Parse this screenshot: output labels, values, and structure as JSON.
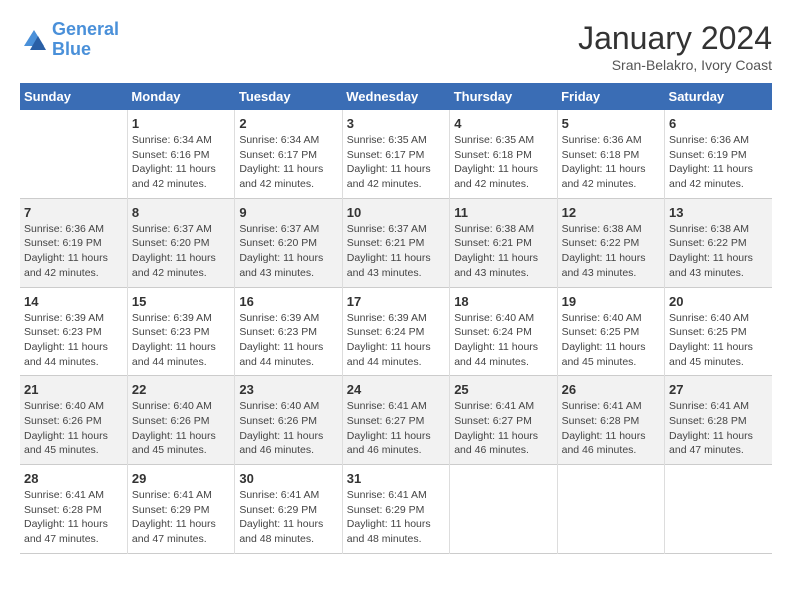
{
  "logo": {
    "text_general": "General",
    "text_blue": "Blue"
  },
  "title": "January 2024",
  "subtitle": "Sran-Belakro, Ivory Coast",
  "days_of_week": [
    "Sunday",
    "Monday",
    "Tuesday",
    "Wednesday",
    "Thursday",
    "Friday",
    "Saturday"
  ],
  "weeks": [
    [
      {
        "num": "",
        "info": ""
      },
      {
        "num": "1",
        "info": "Sunrise: 6:34 AM\nSunset: 6:16 PM\nDaylight: 11 hours\nand 42 minutes."
      },
      {
        "num": "2",
        "info": "Sunrise: 6:34 AM\nSunset: 6:17 PM\nDaylight: 11 hours\nand 42 minutes."
      },
      {
        "num": "3",
        "info": "Sunrise: 6:35 AM\nSunset: 6:17 PM\nDaylight: 11 hours\nand 42 minutes."
      },
      {
        "num": "4",
        "info": "Sunrise: 6:35 AM\nSunset: 6:18 PM\nDaylight: 11 hours\nand 42 minutes."
      },
      {
        "num": "5",
        "info": "Sunrise: 6:36 AM\nSunset: 6:18 PM\nDaylight: 11 hours\nand 42 minutes."
      },
      {
        "num": "6",
        "info": "Sunrise: 6:36 AM\nSunset: 6:19 PM\nDaylight: 11 hours\nand 42 minutes."
      }
    ],
    [
      {
        "num": "7",
        "info": "Sunrise: 6:36 AM\nSunset: 6:19 PM\nDaylight: 11 hours\nand 42 minutes."
      },
      {
        "num": "8",
        "info": "Sunrise: 6:37 AM\nSunset: 6:20 PM\nDaylight: 11 hours\nand 42 minutes."
      },
      {
        "num": "9",
        "info": "Sunrise: 6:37 AM\nSunset: 6:20 PM\nDaylight: 11 hours\nand 43 minutes."
      },
      {
        "num": "10",
        "info": "Sunrise: 6:37 AM\nSunset: 6:21 PM\nDaylight: 11 hours\nand 43 minutes."
      },
      {
        "num": "11",
        "info": "Sunrise: 6:38 AM\nSunset: 6:21 PM\nDaylight: 11 hours\nand 43 minutes."
      },
      {
        "num": "12",
        "info": "Sunrise: 6:38 AM\nSunset: 6:22 PM\nDaylight: 11 hours\nand 43 minutes."
      },
      {
        "num": "13",
        "info": "Sunrise: 6:38 AM\nSunset: 6:22 PM\nDaylight: 11 hours\nand 43 minutes."
      }
    ],
    [
      {
        "num": "14",
        "info": "Sunrise: 6:39 AM\nSunset: 6:23 PM\nDaylight: 11 hours\nand 44 minutes."
      },
      {
        "num": "15",
        "info": "Sunrise: 6:39 AM\nSunset: 6:23 PM\nDaylight: 11 hours\nand 44 minutes."
      },
      {
        "num": "16",
        "info": "Sunrise: 6:39 AM\nSunset: 6:23 PM\nDaylight: 11 hours\nand 44 minutes."
      },
      {
        "num": "17",
        "info": "Sunrise: 6:39 AM\nSunset: 6:24 PM\nDaylight: 11 hours\nand 44 minutes."
      },
      {
        "num": "18",
        "info": "Sunrise: 6:40 AM\nSunset: 6:24 PM\nDaylight: 11 hours\nand 44 minutes."
      },
      {
        "num": "19",
        "info": "Sunrise: 6:40 AM\nSunset: 6:25 PM\nDaylight: 11 hours\nand 45 minutes."
      },
      {
        "num": "20",
        "info": "Sunrise: 6:40 AM\nSunset: 6:25 PM\nDaylight: 11 hours\nand 45 minutes."
      }
    ],
    [
      {
        "num": "21",
        "info": "Sunrise: 6:40 AM\nSunset: 6:26 PM\nDaylight: 11 hours\nand 45 minutes."
      },
      {
        "num": "22",
        "info": "Sunrise: 6:40 AM\nSunset: 6:26 PM\nDaylight: 11 hours\nand 45 minutes."
      },
      {
        "num": "23",
        "info": "Sunrise: 6:40 AM\nSunset: 6:26 PM\nDaylight: 11 hours\nand 46 minutes."
      },
      {
        "num": "24",
        "info": "Sunrise: 6:41 AM\nSunset: 6:27 PM\nDaylight: 11 hours\nand 46 minutes."
      },
      {
        "num": "25",
        "info": "Sunrise: 6:41 AM\nSunset: 6:27 PM\nDaylight: 11 hours\nand 46 minutes."
      },
      {
        "num": "26",
        "info": "Sunrise: 6:41 AM\nSunset: 6:28 PM\nDaylight: 11 hours\nand 46 minutes."
      },
      {
        "num": "27",
        "info": "Sunrise: 6:41 AM\nSunset: 6:28 PM\nDaylight: 11 hours\nand 47 minutes."
      }
    ],
    [
      {
        "num": "28",
        "info": "Sunrise: 6:41 AM\nSunset: 6:28 PM\nDaylight: 11 hours\nand 47 minutes."
      },
      {
        "num": "29",
        "info": "Sunrise: 6:41 AM\nSunset: 6:29 PM\nDaylight: 11 hours\nand 47 minutes."
      },
      {
        "num": "30",
        "info": "Sunrise: 6:41 AM\nSunset: 6:29 PM\nDaylight: 11 hours\nand 48 minutes."
      },
      {
        "num": "31",
        "info": "Sunrise: 6:41 AM\nSunset: 6:29 PM\nDaylight: 11 hours\nand 48 minutes."
      },
      {
        "num": "",
        "info": ""
      },
      {
        "num": "",
        "info": ""
      },
      {
        "num": "",
        "info": ""
      }
    ]
  ]
}
